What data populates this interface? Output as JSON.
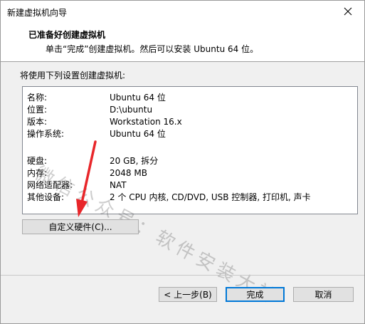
{
  "window": {
    "title": "新建虚拟机向导"
  },
  "header": {
    "title": "已准备好创建虚拟机",
    "subtitle": "单击“完成”创建虚拟机。然后可以安装 Ubuntu 64 位。"
  },
  "summary": {
    "label": "将使用下列设置创建虚拟机:",
    "rows": [
      {
        "key": "名称:",
        "value": "Ubuntu 64 位"
      },
      {
        "key": "位置:",
        "value": "D:\\ubuntu"
      },
      {
        "key": "版本:",
        "value": "Workstation 16.x"
      },
      {
        "key": "操作系统:",
        "value": "Ubuntu 64 位"
      },
      {
        "key": "",
        "value": ""
      },
      {
        "key": "硬盘:",
        "value": "20 GB, 拆分"
      },
      {
        "key": "内存:",
        "value": "2048 MB"
      },
      {
        "key": "网络适配器:",
        "value": "NAT"
      },
      {
        "key": "其他设备:",
        "value": "2 个 CPU 内核, CD/DVD, USB 控制器, 打印机, 声卡"
      }
    ]
  },
  "watermark": "微信公众号：软件安装大神",
  "buttons": {
    "customize": "自定义硬件(C)...",
    "back": "< 上一步(B)",
    "finish": "完成",
    "cancel": "取消"
  },
  "colors": {
    "accent": "#0078d7",
    "arrow": "#e8262a"
  }
}
